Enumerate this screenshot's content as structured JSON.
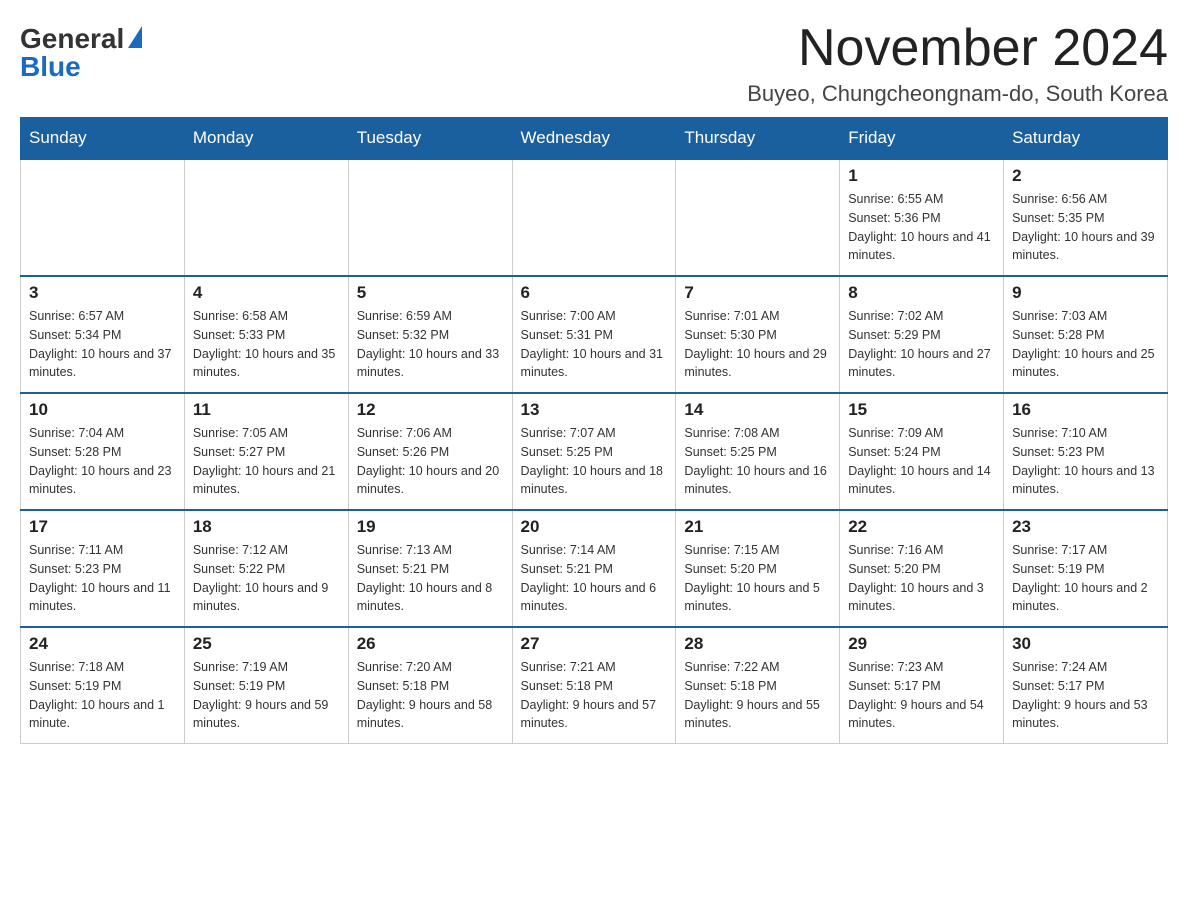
{
  "header": {
    "logo_general": "General",
    "logo_blue": "Blue",
    "month_title": "November 2024",
    "location": "Buyeo, Chungcheongnam-do, South Korea"
  },
  "days_of_week": [
    "Sunday",
    "Monday",
    "Tuesday",
    "Wednesday",
    "Thursday",
    "Friday",
    "Saturday"
  ],
  "weeks": [
    [
      {
        "day": "",
        "sunrise": "",
        "sunset": "",
        "daylight": ""
      },
      {
        "day": "",
        "sunrise": "",
        "sunset": "",
        "daylight": ""
      },
      {
        "day": "",
        "sunrise": "",
        "sunset": "",
        "daylight": ""
      },
      {
        "day": "",
        "sunrise": "",
        "sunset": "",
        "daylight": ""
      },
      {
        "day": "",
        "sunrise": "",
        "sunset": "",
        "daylight": ""
      },
      {
        "day": "1",
        "sunrise": "Sunrise: 6:55 AM",
        "sunset": "Sunset: 5:36 PM",
        "daylight": "Daylight: 10 hours and 41 minutes."
      },
      {
        "day": "2",
        "sunrise": "Sunrise: 6:56 AM",
        "sunset": "Sunset: 5:35 PM",
        "daylight": "Daylight: 10 hours and 39 minutes."
      }
    ],
    [
      {
        "day": "3",
        "sunrise": "Sunrise: 6:57 AM",
        "sunset": "Sunset: 5:34 PM",
        "daylight": "Daylight: 10 hours and 37 minutes."
      },
      {
        "day": "4",
        "sunrise": "Sunrise: 6:58 AM",
        "sunset": "Sunset: 5:33 PM",
        "daylight": "Daylight: 10 hours and 35 minutes."
      },
      {
        "day": "5",
        "sunrise": "Sunrise: 6:59 AM",
        "sunset": "Sunset: 5:32 PM",
        "daylight": "Daylight: 10 hours and 33 minutes."
      },
      {
        "day": "6",
        "sunrise": "Sunrise: 7:00 AM",
        "sunset": "Sunset: 5:31 PM",
        "daylight": "Daylight: 10 hours and 31 minutes."
      },
      {
        "day": "7",
        "sunrise": "Sunrise: 7:01 AM",
        "sunset": "Sunset: 5:30 PM",
        "daylight": "Daylight: 10 hours and 29 minutes."
      },
      {
        "day": "8",
        "sunrise": "Sunrise: 7:02 AM",
        "sunset": "Sunset: 5:29 PM",
        "daylight": "Daylight: 10 hours and 27 minutes."
      },
      {
        "day": "9",
        "sunrise": "Sunrise: 7:03 AM",
        "sunset": "Sunset: 5:28 PM",
        "daylight": "Daylight: 10 hours and 25 minutes."
      }
    ],
    [
      {
        "day": "10",
        "sunrise": "Sunrise: 7:04 AM",
        "sunset": "Sunset: 5:28 PM",
        "daylight": "Daylight: 10 hours and 23 minutes."
      },
      {
        "day": "11",
        "sunrise": "Sunrise: 7:05 AM",
        "sunset": "Sunset: 5:27 PM",
        "daylight": "Daylight: 10 hours and 21 minutes."
      },
      {
        "day": "12",
        "sunrise": "Sunrise: 7:06 AM",
        "sunset": "Sunset: 5:26 PM",
        "daylight": "Daylight: 10 hours and 20 minutes."
      },
      {
        "day": "13",
        "sunrise": "Sunrise: 7:07 AM",
        "sunset": "Sunset: 5:25 PM",
        "daylight": "Daylight: 10 hours and 18 minutes."
      },
      {
        "day": "14",
        "sunrise": "Sunrise: 7:08 AM",
        "sunset": "Sunset: 5:25 PM",
        "daylight": "Daylight: 10 hours and 16 minutes."
      },
      {
        "day": "15",
        "sunrise": "Sunrise: 7:09 AM",
        "sunset": "Sunset: 5:24 PM",
        "daylight": "Daylight: 10 hours and 14 minutes."
      },
      {
        "day": "16",
        "sunrise": "Sunrise: 7:10 AM",
        "sunset": "Sunset: 5:23 PM",
        "daylight": "Daylight: 10 hours and 13 minutes."
      }
    ],
    [
      {
        "day": "17",
        "sunrise": "Sunrise: 7:11 AM",
        "sunset": "Sunset: 5:23 PM",
        "daylight": "Daylight: 10 hours and 11 minutes."
      },
      {
        "day": "18",
        "sunrise": "Sunrise: 7:12 AM",
        "sunset": "Sunset: 5:22 PM",
        "daylight": "Daylight: 10 hours and 9 minutes."
      },
      {
        "day": "19",
        "sunrise": "Sunrise: 7:13 AM",
        "sunset": "Sunset: 5:21 PM",
        "daylight": "Daylight: 10 hours and 8 minutes."
      },
      {
        "day": "20",
        "sunrise": "Sunrise: 7:14 AM",
        "sunset": "Sunset: 5:21 PM",
        "daylight": "Daylight: 10 hours and 6 minutes."
      },
      {
        "day": "21",
        "sunrise": "Sunrise: 7:15 AM",
        "sunset": "Sunset: 5:20 PM",
        "daylight": "Daylight: 10 hours and 5 minutes."
      },
      {
        "day": "22",
        "sunrise": "Sunrise: 7:16 AM",
        "sunset": "Sunset: 5:20 PM",
        "daylight": "Daylight: 10 hours and 3 minutes."
      },
      {
        "day": "23",
        "sunrise": "Sunrise: 7:17 AM",
        "sunset": "Sunset: 5:19 PM",
        "daylight": "Daylight: 10 hours and 2 minutes."
      }
    ],
    [
      {
        "day": "24",
        "sunrise": "Sunrise: 7:18 AM",
        "sunset": "Sunset: 5:19 PM",
        "daylight": "Daylight: 10 hours and 1 minute."
      },
      {
        "day": "25",
        "sunrise": "Sunrise: 7:19 AM",
        "sunset": "Sunset: 5:19 PM",
        "daylight": "Daylight: 9 hours and 59 minutes."
      },
      {
        "day": "26",
        "sunrise": "Sunrise: 7:20 AM",
        "sunset": "Sunset: 5:18 PM",
        "daylight": "Daylight: 9 hours and 58 minutes."
      },
      {
        "day": "27",
        "sunrise": "Sunrise: 7:21 AM",
        "sunset": "Sunset: 5:18 PM",
        "daylight": "Daylight: 9 hours and 57 minutes."
      },
      {
        "day": "28",
        "sunrise": "Sunrise: 7:22 AM",
        "sunset": "Sunset: 5:18 PM",
        "daylight": "Daylight: 9 hours and 55 minutes."
      },
      {
        "day": "29",
        "sunrise": "Sunrise: 7:23 AM",
        "sunset": "Sunset: 5:17 PM",
        "daylight": "Daylight: 9 hours and 54 minutes."
      },
      {
        "day": "30",
        "sunrise": "Sunrise: 7:24 AM",
        "sunset": "Sunset: 5:17 PM",
        "daylight": "Daylight: 9 hours and 53 minutes."
      }
    ]
  ]
}
